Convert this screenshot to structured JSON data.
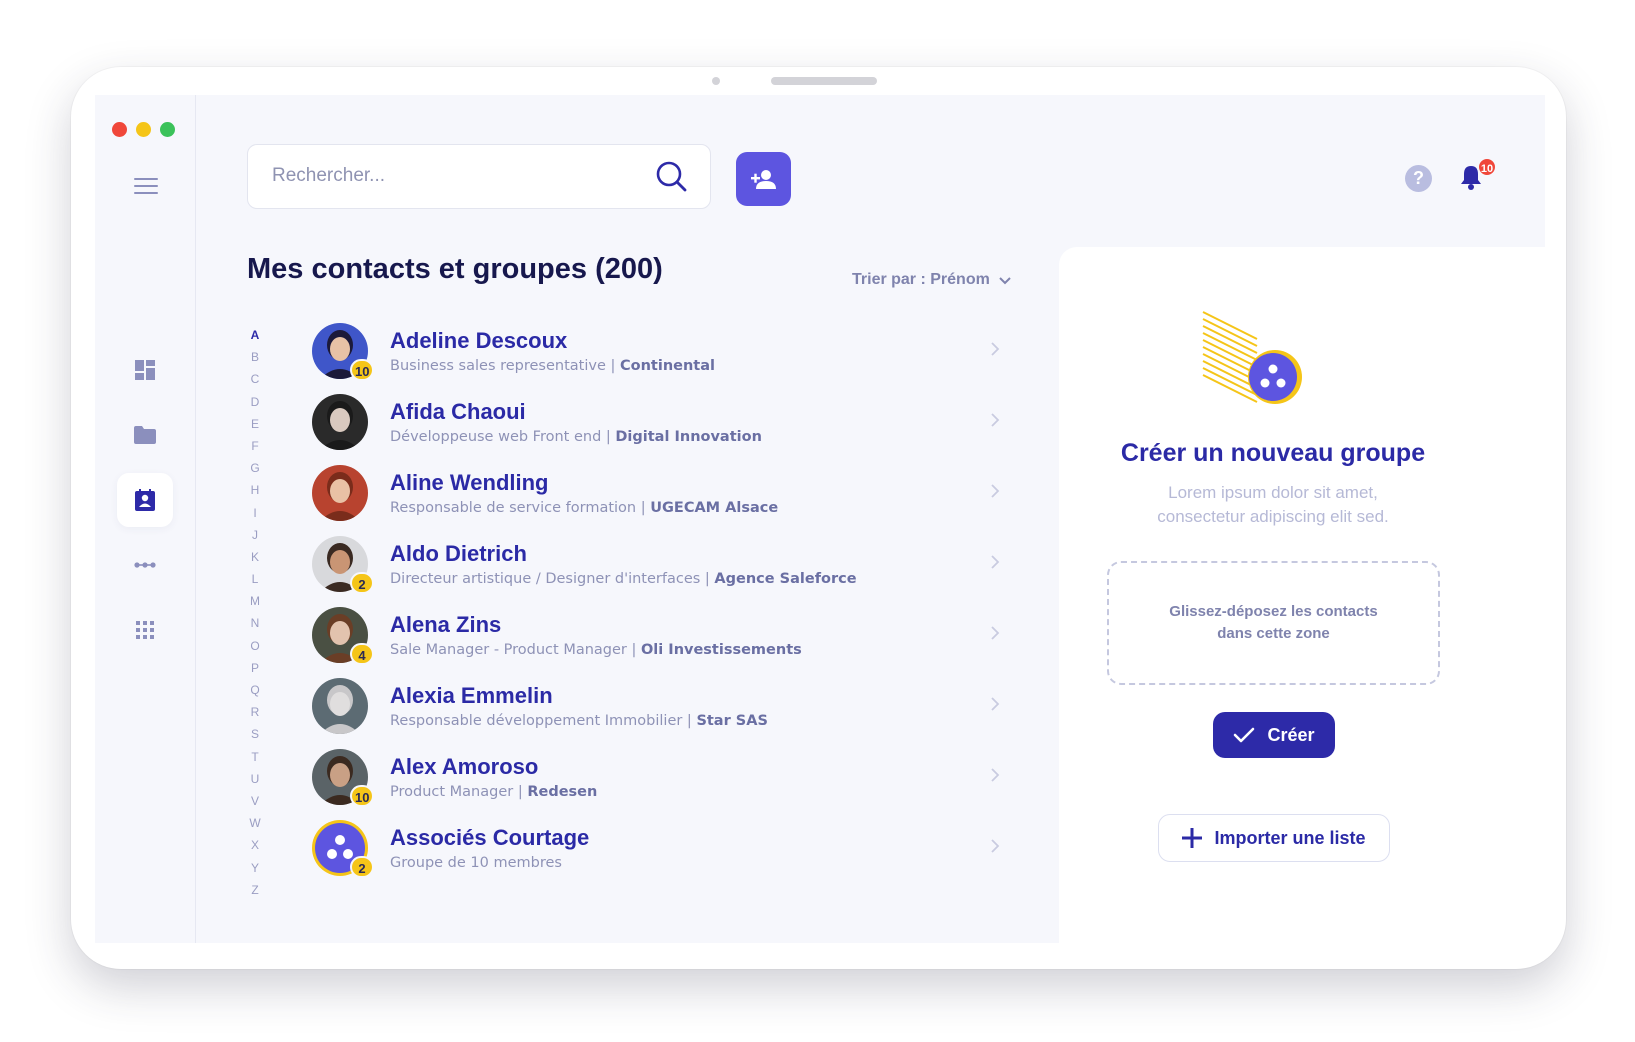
{
  "header": {
    "search_placeholder": "Rechercher...",
    "notification_count": "10",
    "help_label": "?"
  },
  "main": {
    "title": "Mes contacts et groupes (200)",
    "sort_label": "Trier par : Prénom",
    "alphabet": [
      "A",
      "B",
      "C",
      "D",
      "E",
      "F",
      "G",
      "H",
      "I",
      "J",
      "K",
      "L",
      "M",
      "N",
      "O",
      "P",
      "Q",
      "R",
      "S",
      "T",
      "U",
      "V",
      "W",
      "X",
      "Y",
      "Z"
    ],
    "active_letter": "A",
    "contacts": [
      {
        "name": "Adeline Descoux",
        "role": "Business sales representative |",
        "company": "Continental",
        "badge": "10"
      },
      {
        "name": "Afida Chaoui",
        "role": "Développeuse web Front end  |",
        "company": "Digital Innovation",
        "badge": ""
      },
      {
        "name": "Aline Wendling",
        "role": "Responsable de service formation |",
        "company": "UGECAM Alsace",
        "badge": ""
      },
      {
        "name": "Aldo Dietrich",
        "role": "Directeur artistique / Designer d'interfaces |",
        "company": "Agence Saleforce",
        "badge": "2"
      },
      {
        "name": "Alena Zins",
        "role": "Sale Manager  - Product Manager |",
        "company": "Oli Investissements",
        "badge": "4"
      },
      {
        "name": "Alexia Emmelin",
        "role": "Responsable développement Immobilier  |",
        "company": "Star SAS",
        "badge": ""
      },
      {
        "name": "Alex Amoroso",
        "role": "Product Manager |",
        "company": "Redesen",
        "badge": "10"
      },
      {
        "name": "Associés Courtage",
        "role": "Groupe de 10 membres",
        "company": "",
        "badge": "2"
      }
    ]
  },
  "group_panel": {
    "title": "Créer un nouveau groupe",
    "description": "Lorem ipsum dolor sit amet, consectetur adipiscing elit sed.",
    "dropzone_text": "Glissez-déposez les contacts dans cette zone",
    "create_label": "Créer",
    "import_label": "Importer une liste"
  },
  "colors": {
    "primary": "#2d2aa8",
    "accent": "#5d55e0",
    "badge_yellow": "#f5c518",
    "notification_red": "#f0473a"
  }
}
